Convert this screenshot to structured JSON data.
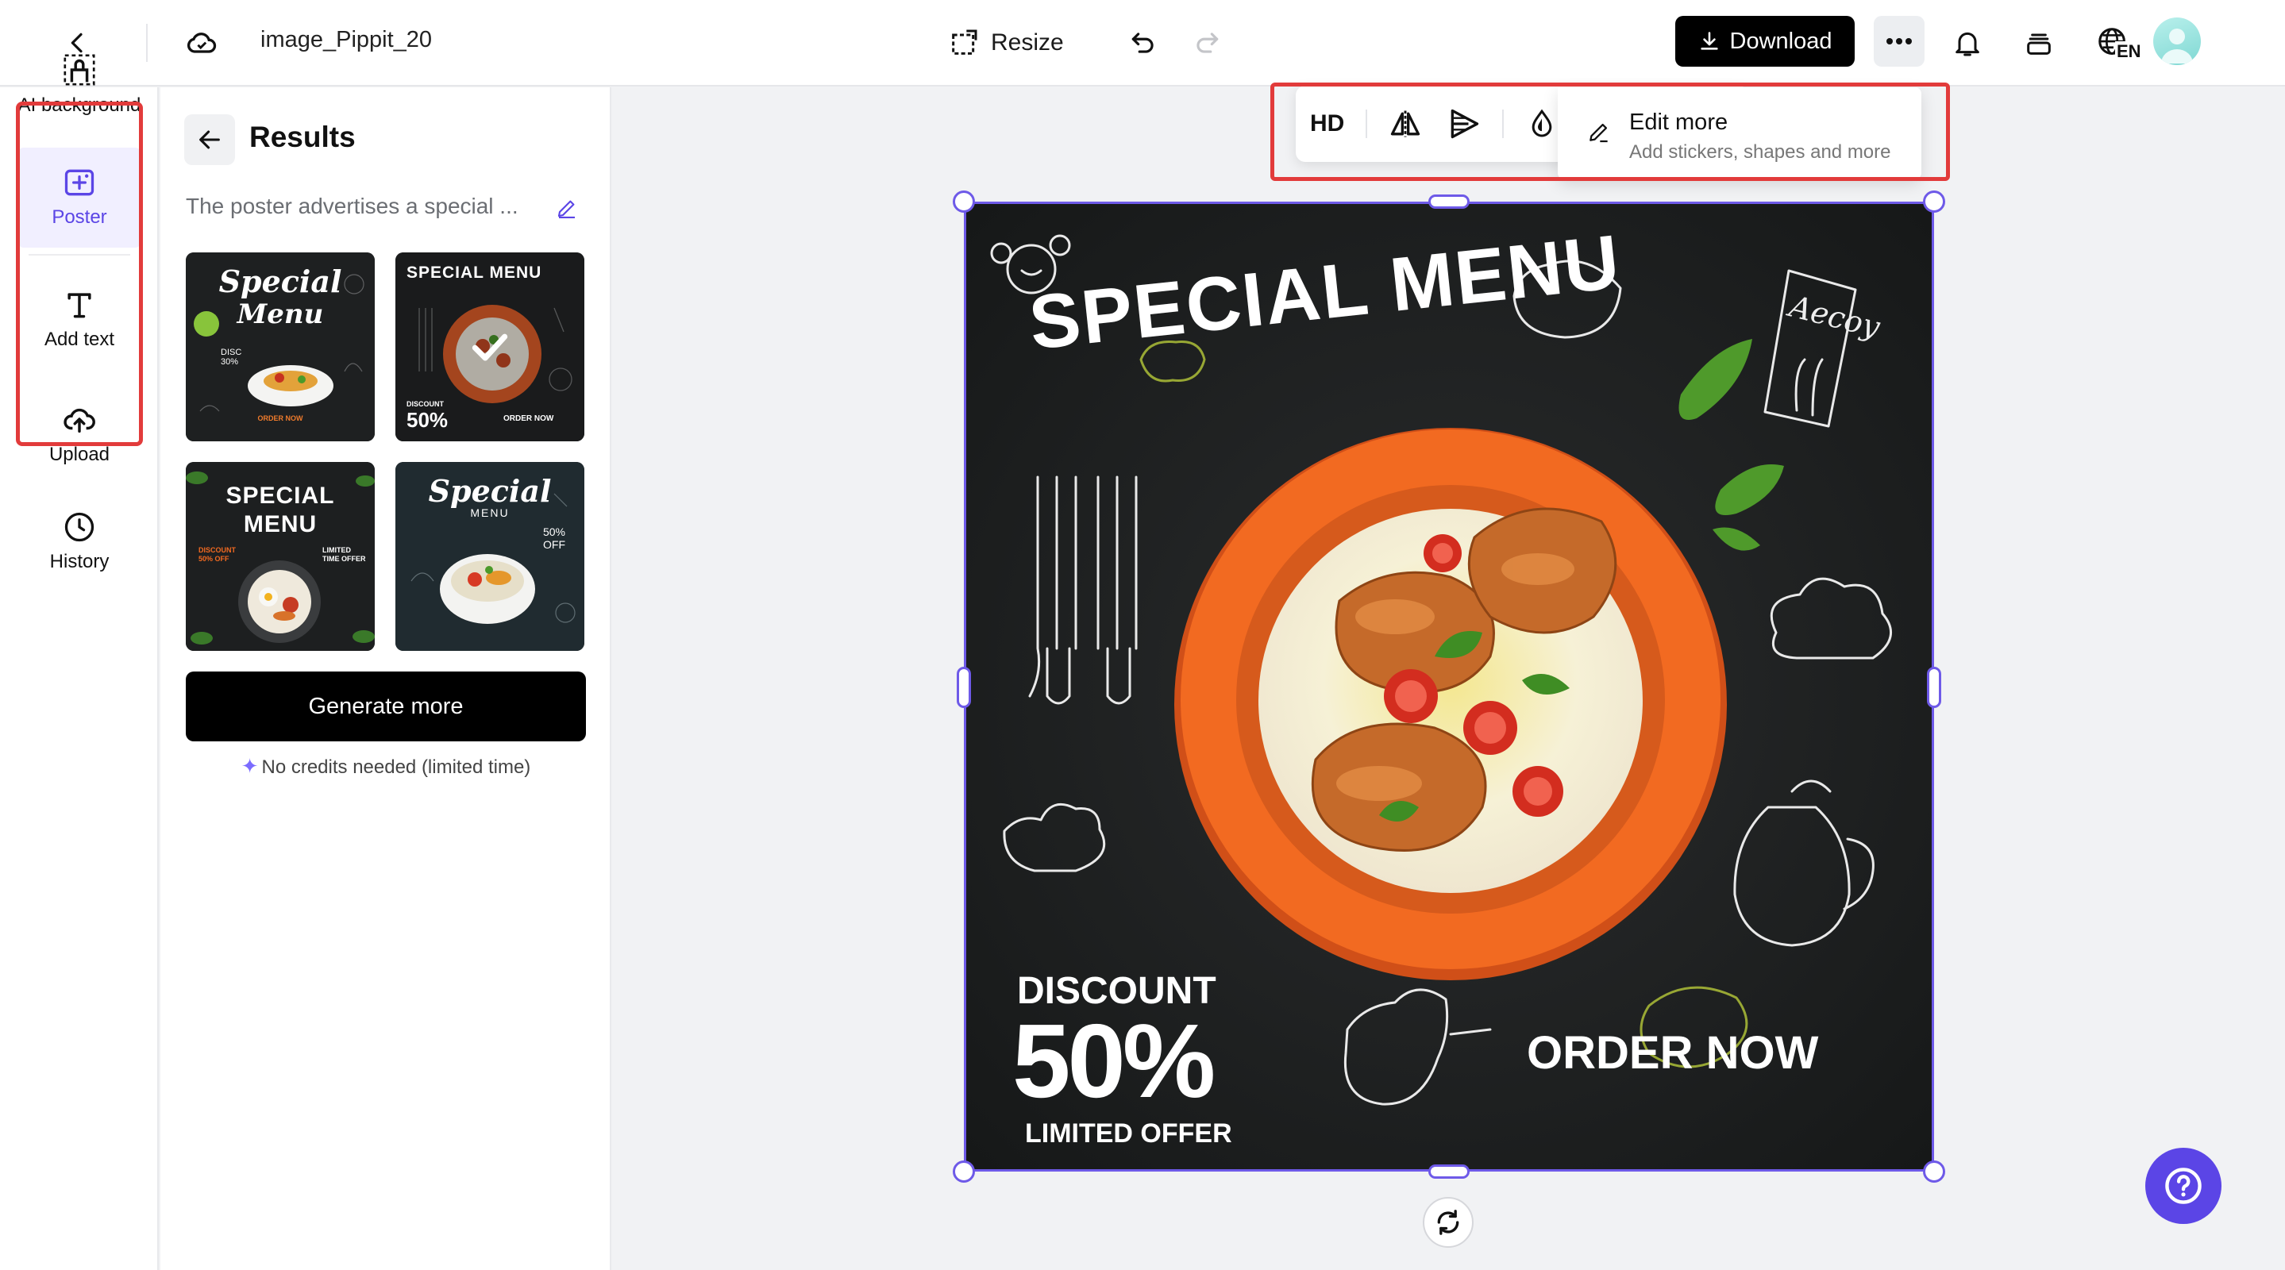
{
  "header": {
    "file_name": "image_Pippit_20",
    "resize_label": "Resize",
    "download_label": "Download",
    "language_code": "EN"
  },
  "rail": {
    "items": [
      {
        "label": "AI background",
        "icon": "ai-background-icon"
      },
      {
        "label": "Poster",
        "icon": "poster-icon",
        "active": true
      },
      {
        "label": "Add text",
        "icon": "text-icon"
      },
      {
        "label": "Upload",
        "icon": "upload-cloud-icon"
      },
      {
        "label": "History",
        "icon": "clock-icon"
      }
    ]
  },
  "results": {
    "title": "Results",
    "prompt": "The poster advertises a special ...",
    "generate_label": "Generate more",
    "credits_note": "No credits needed (limited time)",
    "thumbnails": [
      {
        "heading": "Special",
        "heading2": "Menu",
        "small": "DISC 30%",
        "footer": "ORDER NOW"
      },
      {
        "heading": "SPECIAL MENU",
        "discount_label": "DISCOUNT",
        "discount_value": "50%",
        "footer": "ORDER NOW",
        "selected": true
      },
      {
        "heading": "SPECIAL",
        "heading2": "MENU",
        "small": "DISCOUNT 50% OFF",
        "footer": "LIMITED TIME OFFER"
      },
      {
        "heading": "Special",
        "heading2": "MENU",
        "small": "50% OFF"
      }
    ]
  },
  "toolbar": {
    "hd_label": "HD",
    "edit_more_title": "Edit more",
    "edit_more_subtitle": "Add stickers, shapes and more"
  },
  "poster": {
    "title": "SPECIAL MENU",
    "discount_label": "DISCOUNT",
    "discount_value": "50%",
    "offer_label": "LIMITED OFFER",
    "cta": "ORDER NOW",
    "doodle_text": "Aecoy"
  },
  "colors": {
    "accent": "#5b45e6",
    "highlight": "#e23b3b",
    "bowl": "#f26a21",
    "chalkboard": "#1f2122"
  }
}
